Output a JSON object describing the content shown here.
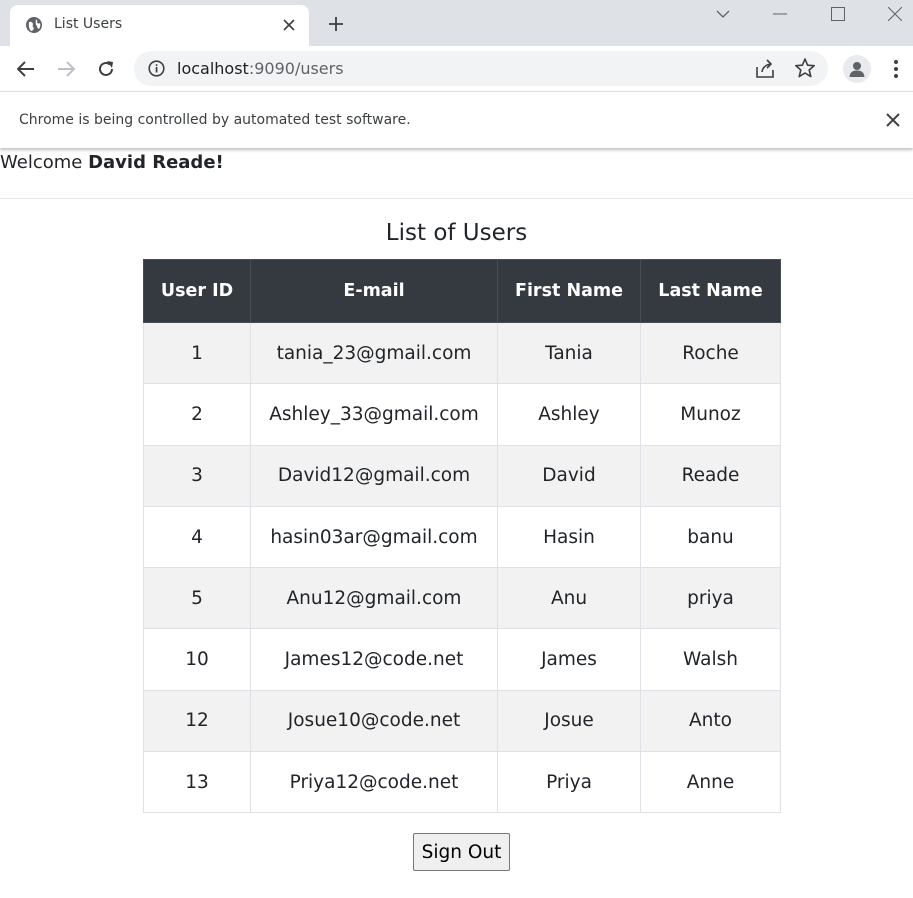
{
  "browser": {
    "tab_title": "List Users",
    "url_host": "localhost",
    "url_path": ":9090/users",
    "infobar_message": "Chrome is being controlled by automated test software."
  },
  "page": {
    "welcome_prefix": "Welcome",
    "welcome_name": "David Reade!",
    "title": "List of Users",
    "signout_label": "Sign Out"
  },
  "table": {
    "headers": [
      "User ID",
      "E-mail",
      "First Name",
      "Last Name"
    ],
    "rows": [
      [
        "1",
        "tania_23@gmail.com",
        "Tania",
        "Roche"
      ],
      [
        "2",
        "Ashley_33@gmail.com",
        "Ashley",
        "Munoz"
      ],
      [
        "3",
        "David12@gmail.com",
        "David",
        "Reade"
      ],
      [
        "4",
        "hasin03ar@gmail.com",
        "Hasin",
        "banu"
      ],
      [
        "5",
        "Anu12@gmail.com",
        "Anu",
        "priya"
      ],
      [
        "10",
        "James12@code.net",
        "James",
        "Walsh"
      ],
      [
        "12",
        "Josue10@code.net",
        "Josue",
        "Anto"
      ],
      [
        "13",
        "Priya12@code.net",
        "Priya",
        "Anne"
      ]
    ]
  },
  "colors": {
    "table_header_bg": "#343a40",
    "striped_row_bg": "#f2f2f2",
    "chrome_tabstrip": "#dee1e6"
  },
  "icons": {
    "favicon": "globe-icon",
    "tab_close": "close-icon",
    "new_tab": "plus-icon",
    "back": "back-arrow-icon",
    "forward": "forward-arrow-icon",
    "reload": "reload-icon",
    "site_info": "info-icon",
    "share": "share-icon",
    "bookmark": "star-icon",
    "profile": "profile-icon",
    "menu": "kebab-menu-icon"
  }
}
